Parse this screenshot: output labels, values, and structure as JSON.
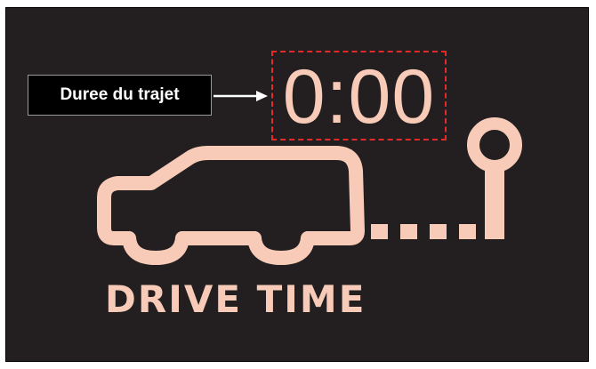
{
  "callout": {
    "label": "Duree du trajet"
  },
  "display": {
    "time": "0:00",
    "caption": "DRIVE TIME"
  },
  "colors": {
    "background": "#231f20",
    "icon": "#f8cbb8",
    "highlight_border": "#e32b2b",
    "callout_bg": "#000000",
    "callout_text": "#ffffff",
    "arrow": "#ffffff"
  },
  "icons": [
    "car-icon",
    "dotted-route-icon",
    "destination-pin-icon",
    "arrow-icon"
  ]
}
